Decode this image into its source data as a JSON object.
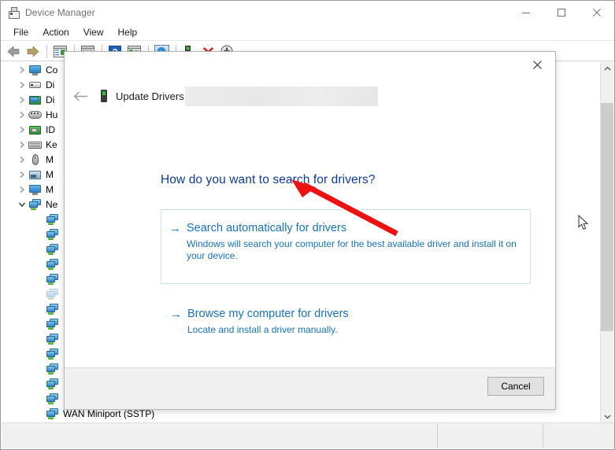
{
  "window": {
    "title": "Device Manager",
    "icon": "device-manager-icon",
    "controls": {
      "minimize": "minimize-icon",
      "maximize": "maximize-icon",
      "close": "close-icon"
    }
  },
  "menu": {
    "items": [
      {
        "label": "File"
      },
      {
        "label": "Action"
      },
      {
        "label": "View"
      },
      {
        "label": "Help"
      }
    ]
  },
  "toolbar": {
    "buttons": [
      {
        "name": "back-icon"
      },
      {
        "name": "forward-icon"
      },
      {
        "name": "show-hide-console-tree-icon"
      },
      {
        "name": "properties-icon"
      },
      {
        "name": "help-icon"
      },
      {
        "name": "update-driver-icon"
      },
      {
        "name": "scan-for-hardware-changes-icon"
      },
      {
        "name": "add-legacy-hardware-icon"
      },
      {
        "name": "uninstall-device-icon"
      },
      {
        "name": "disable-device-icon"
      }
    ]
  },
  "tree": {
    "items": [
      {
        "label": "Co",
        "icon": "computer-icon",
        "expanded": false,
        "indent": 1,
        "disabled": false
      },
      {
        "label": "Di",
        "icon": "disk-drive-icon",
        "expanded": false,
        "indent": 1,
        "disabled": false
      },
      {
        "label": "Di",
        "icon": "display-adapter-icon",
        "expanded": false,
        "indent": 1,
        "disabled": false
      },
      {
        "label": "Hu",
        "icon": "human-interface-device-icon",
        "expanded": false,
        "indent": 1,
        "disabled": false
      },
      {
        "label": "ID",
        "icon": "ide-controller-icon",
        "expanded": false,
        "indent": 1,
        "disabled": false
      },
      {
        "label": "Ke",
        "icon": "keyboard-icon",
        "expanded": false,
        "indent": 1,
        "disabled": false
      },
      {
        "label": "M",
        "icon": "mouse-icon",
        "expanded": false,
        "indent": 1,
        "disabled": false
      },
      {
        "label": "M",
        "icon": "modem-icon",
        "expanded": false,
        "indent": 1,
        "disabled": false
      },
      {
        "label": "M",
        "icon": "monitor-icon",
        "expanded": false,
        "indent": 1,
        "disabled": false
      },
      {
        "label": "Ne",
        "icon": "network-adapters-icon",
        "expanded": true,
        "indent": 1,
        "disabled": false
      },
      {
        "label": "",
        "icon": "network-adapter-icon",
        "expanded": null,
        "indent": 2,
        "disabled": false
      },
      {
        "label": "",
        "icon": "network-adapter-icon",
        "expanded": null,
        "indent": 2,
        "disabled": false
      },
      {
        "label": "",
        "icon": "network-adapter-icon",
        "expanded": null,
        "indent": 2,
        "disabled": false
      },
      {
        "label": "",
        "icon": "network-adapter-icon",
        "expanded": null,
        "indent": 2,
        "disabled": false
      },
      {
        "label": "",
        "icon": "network-adapter-icon",
        "expanded": null,
        "indent": 2,
        "disabled": false
      },
      {
        "label": "",
        "icon": "network-adapter-icon",
        "expanded": null,
        "indent": 2,
        "disabled": true
      },
      {
        "label": "",
        "icon": "network-adapter-icon",
        "expanded": null,
        "indent": 2,
        "disabled": false
      },
      {
        "label": "",
        "icon": "network-adapter-icon",
        "expanded": null,
        "indent": 2,
        "disabled": false
      },
      {
        "label": "",
        "icon": "network-adapter-icon",
        "expanded": null,
        "indent": 2,
        "disabled": false
      },
      {
        "label": "",
        "icon": "network-adapter-icon",
        "expanded": null,
        "indent": 2,
        "disabled": false
      },
      {
        "label": "",
        "icon": "network-adapter-icon",
        "expanded": null,
        "indent": 2,
        "disabled": false
      },
      {
        "label": "",
        "icon": "network-adapter-icon",
        "expanded": null,
        "indent": 2,
        "disabled": false
      },
      {
        "label": "",
        "icon": "network-adapter-icon",
        "expanded": null,
        "indent": 2,
        "disabled": false
      },
      {
        "label": "WAN Miniport (SSTP)",
        "icon": "network-adapter-icon",
        "expanded": null,
        "indent": 2,
        "disabled": false
      }
    ]
  },
  "scrollbar": {
    "up_arrow": "chevron-up-icon",
    "down_arrow": "chevron-down-icon",
    "thumb": "scrollbar-thumb"
  },
  "status_bar": {
    "main": "",
    "cell2": "",
    "cell3": ""
  },
  "dialog": {
    "close_icon": "close-icon",
    "back_icon": "back-arrow-icon",
    "device_icon": "device-icon",
    "header_title": "Update Drivers",
    "redaction": "",
    "question": "How do you want to search for drivers?",
    "options": [
      {
        "arrow": "→",
        "title": "Search automatically for drivers",
        "desc": "Windows will search your computer for the best available driver and install it on your device."
      },
      {
        "arrow": "→",
        "title": "Browse my computer for drivers",
        "desc": "Locate and install a driver manually."
      }
    ],
    "cancel_label": "Cancel"
  },
  "annotation": {
    "arrow": "red-pointer-arrow",
    "color": "#ee1111"
  },
  "cursor": {
    "name": "mouse-pointer"
  },
  "colors": {
    "link_blue": "#1572c4",
    "heading_blue": "#0c3a9e",
    "option_border": "#cce0f2",
    "annotation_red": "#ee1111",
    "chrome_gray": "#f0f0f0"
  }
}
